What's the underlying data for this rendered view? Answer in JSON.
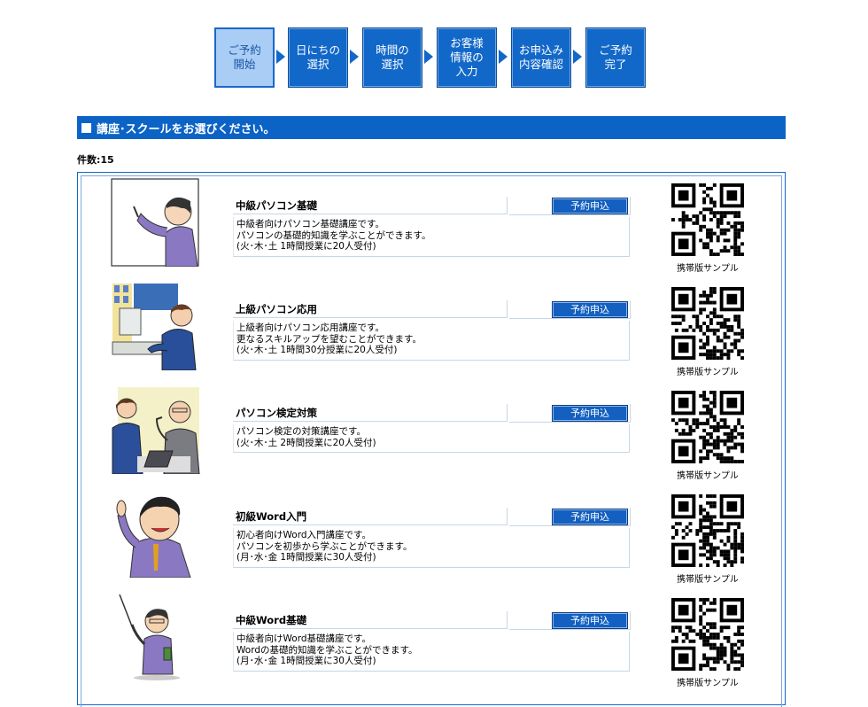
{
  "steps": [
    {
      "label": "ご予約\n開始",
      "active": true
    },
    {
      "label": "日にちの\n選択",
      "active": false
    },
    {
      "label": "時間の\n選択",
      "active": false
    },
    {
      "label": "お客様\n情報の\n入力",
      "active": false
    },
    {
      "label": "お申込み\n内容確認",
      "active": false
    },
    {
      "label": "ご予約\n完了",
      "active": false
    }
  ],
  "section": {
    "title": "講座･スクールをお選びください。"
  },
  "count": {
    "label": "件数:15"
  },
  "courses": [
    {
      "title": "中級パソコン基礎",
      "button": "予約申込",
      "lines": [
        "中級者向けパソコン基礎講座です。",
        "パソコンの基礎的知識を学ぶことができます。",
        "(火･木･土 1時間授業に20人受付)"
      ],
      "qr_label": "携帯版サンプル"
    },
    {
      "title": "上級パソコン応用",
      "button": "予約申込",
      "lines": [
        "上級者向けパソコン応用講座です。",
        "更なるスキルアップを望むことができます。",
        "(火･木･土 1時間30分授業に20人受付)"
      ],
      "qr_label": "携帯版サンプル"
    },
    {
      "title": "パソコン検定対策",
      "button": "予約申込",
      "lines": [
        "パソコン検定の対策講座です。",
        "(火･木･土 2時間授業に20人受付)"
      ],
      "qr_label": "携帯版サンプル"
    },
    {
      "title": "初級Word入門",
      "button": "予約申込",
      "lines": [
        "初心者向けWord入門講座です。",
        "パソコンを初歩から学ぶことができます。",
        "(月･水･金 1時間授業に30人受付)"
      ],
      "qr_label": "携帯版サンプル"
    },
    {
      "title": "中級Word基礎",
      "button": "予約申込",
      "lines": [
        "中級者向けWord基礎講座です。",
        "Wordの基礎的知識を学ぶことができます。",
        "(月･水･金 1時間授業に30人受付)"
      ],
      "qr_label": "携帯版サンプル"
    }
  ],
  "colors": {
    "primary": "#0c63c6",
    "active_step": "#a9cdf4"
  }
}
